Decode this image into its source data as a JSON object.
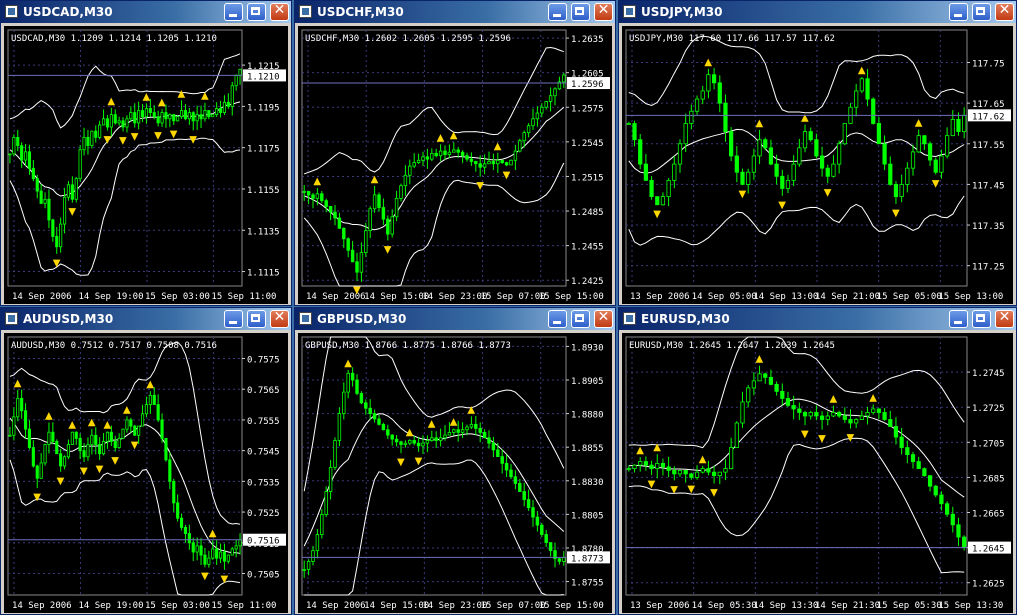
{
  "windows": [
    {
      "id": "usdcad",
      "title": "USDCAD,M30",
      "header": "USDCAD,M30  1.1209 1.1214 1.1205 1.1210",
      "price": "1.1210"
    },
    {
      "id": "usdchf",
      "title": "USDCHF,M30",
      "header": "USDCHF,M30  1.2602 1.2605 1.2595 1.2596",
      "price": "1.2596"
    },
    {
      "id": "usdjpy",
      "title": "USDJPY,M30",
      "header": "USDJPY,M30  117.60 117.66 117.57 117.62",
      "price": "117.62"
    },
    {
      "id": "audusd",
      "title": "AUDUSD,M30",
      "header": "AUDUSD,M30  0.7512 0.7517 0.7508 0.7516",
      "price": "0.7516"
    },
    {
      "id": "gbpusd",
      "title": "GBPUSD,M30",
      "header": "GBPUSD,M30  1.8766 1.8775 1.8766 1.8773",
      "price": "1.8773"
    },
    {
      "id": "eurusd",
      "title": "EURUSD,M30",
      "header": "EURUSD,M30  1.2645 1.2647 1.2639 1.2645",
      "price": "1.2645"
    }
  ],
  "colors": {
    "candle": "#00ff00",
    "band": "#ffffff",
    "fractal": "#ffd700",
    "grid": "#3a3a7a",
    "price_line": "#7070c0",
    "axis_text": "#ffffff"
  },
  "icons": {
    "minimize": "minimize-icon",
    "maximize": "maximize-icon",
    "close": "close-icon",
    "app": "chart-window-icon"
  },
  "chart_data": [
    {
      "type": "candlestick",
      "symbol": "USDCAD",
      "timeframe": "M30",
      "title": "USDCAD,M30  1.1209 1.1214 1.1205 1.1210",
      "y_ticks": [
        "1.1215",
        "1.1195",
        "1.1175",
        "1.1155",
        "1.1135",
        "1.1115"
      ],
      "x_ticks": [
        "14 Sep 2006",
        "14 Sep 19:00",
        "15 Sep 03:00",
        "15 Sep 11:00"
      ],
      "ylim": [
        1.1108,
        1.1232
      ],
      "last_price": 1.121,
      "close": [
        1.1172,
        1.118,
        1.1176,
        1.1169,
        1.1173,
        1.1165,
        1.116,
        1.1154,
        1.1148,
        1.115,
        1.114,
        1.1132,
        1.1127,
        1.1138,
        1.1151,
        1.1157,
        1.115,
        1.116,
        1.1174,
        1.118,
        1.1176,
        1.1183,
        1.118,
        1.1186,
        1.1189,
        1.1185,
        1.1191,
        1.1187,
        1.1188,
        1.1185,
        1.1189,
        1.1192,
        1.1187,
        1.1193,
        1.119,
        1.1194,
        1.1192,
        1.119,
        1.1187,
        1.1192,
        1.1189,
        1.1191,
        1.1188,
        1.119,
        1.1193,
        1.1189,
        1.1192,
        1.1188,
        1.1191,
        1.1189,
        1.1193,
        1.119,
        1.1191,
        1.1194,
        1.1192,
        1.1197,
        1.1195,
        1.1205,
        1.121,
        1.1213
      ]
    },
    {
      "type": "candlestick",
      "symbol": "USDCHF",
      "timeframe": "M30",
      "title": "USDCHF,M30  1.2602 1.2605 1.2595 1.2596",
      "y_ticks": [
        "1.2635",
        "1.2605",
        "1.2575",
        "1.2545",
        "1.2515",
        "1.2485",
        "1.2455",
        "1.2425"
      ],
      "x_ticks": [
        "14 Sep 2006",
        "14 Sep 15:00",
        "14 Sep 23:00",
        "15 Sep 07:00",
        "15 Sep 15:00"
      ],
      "ylim": [
        1.242,
        1.2642
      ],
      "last_price": 1.2596,
      "close": [
        1.2502,
        1.2499,
        1.2496,
        1.25,
        1.2494,
        1.2489,
        1.2484,
        1.2479,
        1.247,
        1.2461,
        1.2451,
        1.2441,
        1.2432,
        1.2449,
        1.2468,
        1.2487,
        1.2499,
        1.2488,
        1.2478,
        1.2465,
        1.248,
        1.2496,
        1.2507,
        1.2516,
        1.2524,
        1.2527,
        1.2529,
        1.2532,
        1.253,
        1.2535,
        1.2533,
        1.2537,
        1.2534,
        1.2536,
        1.2538,
        1.2536,
        1.2533,
        1.253,
        1.2528,
        1.2526,
        1.2523,
        1.2526,
        1.2528,
        1.2526,
        1.2529,
        1.2527,
        1.2525,
        1.2529,
        1.2537,
        1.2546,
        1.2553,
        1.2559,
        1.2565,
        1.257,
        1.2575,
        1.258,
        1.2585,
        1.2591,
        1.2597,
        1.2603
      ]
    },
    {
      "type": "candlestick",
      "symbol": "USDJPY",
      "timeframe": "M30",
      "title": "USDJPY,M30  117.60 117.66 117.57 117.62",
      "y_ticks": [
        "117.75",
        "117.65",
        "117.55",
        "117.45",
        "117.35",
        "117.25"
      ],
      "x_ticks": [
        "13 Sep 2006",
        "14 Sep 05:00",
        "14 Sep 13:00",
        "14 Sep 21:00",
        "15 Sep 05:00",
        "15 Sep 13:00"
      ],
      "ylim": [
        117.2,
        117.83
      ],
      "last_price": 117.62,
      "close": [
        117.6,
        117.56,
        117.5,
        117.46,
        117.42,
        117.4,
        117.42,
        117.46,
        117.5,
        117.55,
        117.6,
        117.63,
        117.66,
        117.68,
        117.72,
        117.7,
        117.65,
        117.58,
        117.52,
        117.48,
        117.45,
        117.48,
        117.52,
        117.56,
        117.54,
        117.5,
        117.47,
        117.44,
        117.46,
        117.5,
        117.54,
        117.58,
        117.56,
        117.52,
        117.49,
        117.47,
        117.5,
        117.55,
        117.6,
        117.64,
        117.68,
        117.71,
        117.66,
        117.6,
        117.55,
        117.5,
        117.45,
        117.42,
        117.45,
        117.49,
        117.53,
        117.57,
        117.55,
        117.51,
        117.48,
        117.52,
        117.57,
        117.61,
        117.58,
        117.62
      ]
    },
    {
      "type": "candlestick",
      "symbol": "AUDUSD",
      "timeframe": "M30",
      "title": "AUDUSD,M30  0.7512 0.7517 0.7508 0.7516",
      "y_ticks": [
        "0.7575",
        "0.7565",
        "0.7555",
        "0.7545",
        "0.7535",
        "0.7525",
        "0.7515",
        "0.7505"
      ],
      "x_ticks": [
        "14 Sep 2006",
        "14 Sep 19:00",
        "15 Sep 03:00",
        "15 Sep 11:00"
      ],
      "ylim": [
        0.7498,
        0.7582
      ],
      "last_price": 0.7516,
      "close": [
        0.755,
        0.7556,
        0.7562,
        0.7558,
        0.7552,
        0.7546,
        0.754,
        0.7536,
        0.7541,
        0.7547,
        0.7551,
        0.7548,
        0.7544,
        0.754,
        0.7543,
        0.7547,
        0.7551,
        0.7549,
        0.7545,
        0.7543,
        0.7547,
        0.755,
        0.7547,
        0.7544,
        0.7548,
        0.7551,
        0.7548,
        0.7546,
        0.7549,
        0.7552,
        0.7555,
        0.7553,
        0.755,
        0.7553,
        0.7557,
        0.756,
        0.7563,
        0.756,
        0.7555,
        0.7549,
        0.7542,
        0.7535,
        0.7528,
        0.7523,
        0.752,
        0.7518,
        0.7515,
        0.7512,
        0.7514,
        0.7511,
        0.7508,
        0.751,
        0.7513,
        0.751,
        0.7512,
        0.7509,
        0.7511,
        0.7513,
        0.7514,
        0.7516
      ]
    },
    {
      "type": "candlestick",
      "symbol": "GBPUSD",
      "timeframe": "M30",
      "title": "GBPUSD,M30  1.8766 1.8775 1.8766 1.8773",
      "y_ticks": [
        "1.8930",
        "1.8905",
        "1.8880",
        "1.8855",
        "1.8830",
        "1.8805",
        "1.8780",
        "1.8755"
      ],
      "x_ticks": [
        "14 Sep 2006",
        "14 Sep 15:00",
        "14 Sep 23:00",
        "15 Sep 07:00",
        "15 Sep 15:00"
      ],
      "ylim": [
        1.8745,
        1.8937
      ],
      "last_price": 1.8773,
      "close": [
        1.8764,
        1.877,
        1.8778,
        1.879,
        1.8805,
        1.8822,
        1.884,
        1.886,
        1.888,
        1.8896,
        1.891,
        1.8905,
        1.8895,
        1.8888,
        1.8884,
        1.888,
        1.8876,
        1.8872,
        1.8868,
        1.8864,
        1.8861,
        1.8859,
        1.8857,
        1.8858,
        1.886,
        1.8858,
        1.8856,
        1.8858,
        1.886,
        1.8862,
        1.886,
        1.8862,
        1.8864,
        1.8866,
        1.8868,
        1.8866,
        1.8868,
        1.887,
        1.8872,
        1.8869,
        1.8866,
        1.8862,
        1.8858,
        1.8853,
        1.8848,
        1.8843,
        1.8838,
        1.8833,
        1.8828,
        1.8822,
        1.8816,
        1.881,
        1.8803,
        1.8797,
        1.879,
        1.8784,
        1.8778,
        1.8772,
        1.877,
        1.8773
      ]
    },
    {
      "type": "candlestick",
      "symbol": "EURUSD",
      "timeframe": "M30",
      "title": "EURUSD,M30  1.2645 1.2647 1.2639 1.2645",
      "y_ticks": [
        "1.2745",
        "1.2725",
        "1.2705",
        "1.2685",
        "1.2665",
        "1.2645",
        "1.2625"
      ],
      "x_ticks": [
        "13 Sep 2006",
        "14 Sep 05:30",
        "14 Sep 13:30",
        "14 Sep 21:30",
        "15 Sep 05:30",
        "15 Sep 13:30"
      ],
      "ylim": [
        1.2618,
        1.2765
      ],
      "last_price": 1.2645,
      "close": [
        1.269,
        1.2692,
        1.2694,
        1.2692,
        1.269,
        1.2693,
        1.2691,
        1.2689,
        1.2687,
        1.2689,
        1.2687,
        1.2685,
        1.2688,
        1.269,
        1.2688,
        1.2686,
        1.2688,
        1.269,
        1.2702,
        1.2716,
        1.2728,
        1.2736,
        1.274,
        1.2744,
        1.2742,
        1.2738,
        1.2734,
        1.273,
        1.2726,
        1.2724,
        1.2722,
        1.272,
        1.2722,
        1.272,
        1.2718,
        1.272,
        1.2722,
        1.272,
        1.2718,
        1.2716,
        1.2718,
        1.272,
        1.2722,
        1.2724,
        1.2722,
        1.2718,
        1.2714,
        1.2708,
        1.2702,
        1.2698,
        1.2694,
        1.269,
        1.2686,
        1.268,
        1.2675,
        1.267,
        1.2664,
        1.2658,
        1.2651,
        1.2645
      ]
    }
  ]
}
